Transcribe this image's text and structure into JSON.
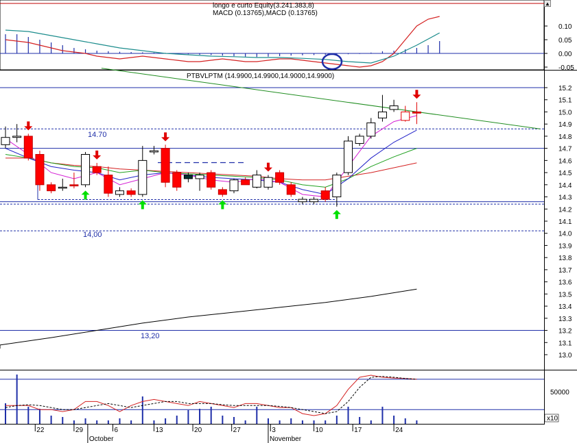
{
  "chart_data": [
    {
      "type": "line",
      "panel": "macd",
      "title_top": "longo e curto Equity(3.241.383,8)",
      "title": "MACD (0.13765),MACD (0.13765)",
      "ylim": [
        -0.06,
        0.15
      ],
      "y_ticks": [
        "0.10",
        "0.05",
        "0.00",
        "-0.05"
      ],
      "y_tick_values": [
        0.1,
        0.05,
        0.0,
        -0.05
      ],
      "series": [
        {
          "role": "macd",
          "color": "#d42020",
          "x": [
            0,
            5,
            10,
            15,
            20,
            25,
            30,
            35,
            40,
            45,
            50,
            55,
            60,
            65,
            70,
            75,
            80,
            85,
            90,
            95,
            100,
            105,
            110,
            115,
            120,
            125,
            130,
            135,
            140,
            145,
            150,
            155,
            160,
            165,
            170,
            175,
            180,
            185,
            190
          ],
          "values": [
            0.05,
            0.045,
            0.04,
            0.03,
            0.02,
            0.01,
            0.005,
            0.0,
            -0.01,
            -0.015,
            -0.02,
            -0.015,
            -0.01,
            -0.015,
            -0.02,
            -0.025,
            -0.03,
            -0.03,
            -0.025,
            -0.02,
            -0.025,
            -0.03,
            -0.03,
            -0.025,
            -0.02,
            -0.02,
            -0.025,
            -0.03,
            -0.035,
            -0.04,
            -0.045,
            -0.05,
            -0.045,
            -0.03,
            0.0,
            0.05,
            0.1,
            0.125,
            0.135
          ]
        },
        {
          "role": "signal",
          "color": "#1b8c8c",
          "x": [
            0,
            10,
            20,
            30,
            40,
            50,
            60,
            70,
            80,
            90,
            100,
            110,
            120,
            130,
            140,
            150,
            160,
            170,
            180,
            190
          ],
          "values": [
            0.085,
            0.08,
            0.065,
            0.05,
            0.035,
            0.02,
            0.01,
            0.0,
            -0.005,
            -0.01,
            -0.012,
            -0.015,
            -0.015,
            -0.018,
            -0.022,
            -0.03,
            -0.035,
            -0.01,
            0.03,
            0.075
          ]
        }
      ],
      "histogram": {
        "color": "#1e2ea8",
        "x": [
          0,
          5,
          10,
          15,
          20,
          25,
          30,
          35,
          40,
          45,
          50,
          55,
          60,
          65,
          70,
          75,
          80,
          85,
          90,
          95,
          100,
          105,
          110,
          115,
          120,
          125,
          130,
          135,
          140,
          145,
          150,
          155,
          160,
          165,
          170,
          175,
          180,
          185,
          190
        ],
        "values": [
          0.07,
          0.07,
          0.06,
          0.05,
          0.04,
          0.03,
          0.02,
          0.015,
          0.01,
          0.008,
          0.006,
          0.005,
          0.004,
          0.003,
          0.002,
          0.0,
          -0.003,
          -0.005,
          -0.006,
          -0.008,
          -0.01,
          -0.012,
          -0.013,
          -0.012,
          -0.01,
          -0.008,
          -0.007,
          -0.006,
          -0.005,
          -0.004,
          -0.003,
          -0.002,
          0.003,
          0.008,
          0.01,
          0.015,
          0.02,
          0.03,
          0.045
        ]
      },
      "hline": 0.0
    },
    {
      "type": "candlestick",
      "panel": "price",
      "title": "PTBVLPTM (14.9900,14.9900,14.9000,14.9900)",
      "ylim": [
        12.82,
        15.29
      ],
      "y_ticks": [
        "15.2",
        "15.1",
        "15.0",
        "14.9",
        "14.8",
        "14.7",
        "14.6",
        "14.5",
        "14.4",
        "14.3",
        "14.2",
        "14.1",
        "14.0",
        "13.9",
        "13.8",
        "13.7",
        "13.6",
        "13.5",
        "13.4",
        "13.3",
        "13.2",
        "13.1",
        "13.0"
      ],
      "y_tick_values": [
        15.2,
        15.1,
        15.0,
        14.9,
        14.8,
        14.7,
        14.6,
        14.5,
        14.4,
        14.3,
        14.2,
        14.1,
        14.0,
        13.9,
        13.8,
        13.7,
        13.6,
        13.5,
        13.4,
        13.3,
        13.2,
        13.1,
        13.0
      ],
      "annotations": [
        "14.70",
        "14,00",
        "13,20"
      ],
      "candles": [
        {
          "x": 0,
          "o": 14.73,
          "h": 14.88,
          "l": 14.7,
          "c": 14.79,
          "fill": "hollow"
        },
        {
          "x": 5,
          "o": 14.79,
          "h": 14.9,
          "l": 14.75,
          "c": 14.8,
          "fill": "hollow"
        },
        {
          "x": 10,
          "o": 14.8,
          "h": 14.82,
          "l": 14.6,
          "c": 14.62,
          "fill": "red"
        },
        {
          "x": 15,
          "o": 14.65,
          "h": 14.68,
          "l": 14.35,
          "c": 14.4,
          "fill": "red"
        },
        {
          "x": 20,
          "o": 14.4,
          "h": 14.42,
          "l": 14.33,
          "c": 14.35,
          "fill": "red"
        },
        {
          "x": 25,
          "o": 14.38,
          "h": 14.45,
          "l": 14.35,
          "c": 14.38,
          "fill": "hollow"
        },
        {
          "x": 30,
          "o": 14.4,
          "h": 14.5,
          "l": 14.37,
          "c": 14.39,
          "fill": "red"
        },
        {
          "x": 35,
          "o": 14.4,
          "h": 14.67,
          "l": 14.38,
          "c": 14.65,
          "fill": "hollow"
        },
        {
          "x": 40,
          "o": 14.55,
          "h": 14.58,
          "l": 14.48,
          "c": 14.5,
          "fill": "red"
        },
        {
          "x": 45,
          "o": 14.48,
          "h": 14.55,
          "l": 14.3,
          "c": 14.33,
          "fill": "red"
        },
        {
          "x": 50,
          "o": 14.32,
          "h": 14.38,
          "l": 14.3,
          "c": 14.35,
          "fill": "hollow"
        },
        {
          "x": 55,
          "o": 14.35,
          "h": 14.37,
          "l": 14.3,
          "c": 14.32,
          "fill": "red"
        },
        {
          "x": 60,
          "o": 14.32,
          "h": 14.72,
          "l": 14.3,
          "c": 14.6,
          "fill": "hollow"
        },
        {
          "x": 65,
          "o": 14.67,
          "h": 14.72,
          "l": 14.65,
          "c": 14.68,
          "fill": "hollow"
        },
        {
          "x": 70,
          "o": 14.7,
          "h": 14.73,
          "l": 14.38,
          "c": 14.42,
          "fill": "red"
        },
        {
          "x": 75,
          "o": 14.5,
          "h": 14.52,
          "l": 14.35,
          "c": 14.38,
          "fill": "red"
        },
        {
          "x": 80,
          "o": 14.45,
          "h": 14.5,
          "l": 14.42,
          "c": 14.48,
          "fill": "dark"
        },
        {
          "x": 85,
          "o": 14.48,
          "h": 14.5,
          "l": 14.35,
          "c": 14.45,
          "fill": "hollow"
        },
        {
          "x": 90,
          "o": 14.5,
          "h": 14.52,
          "l": 14.36,
          "c": 14.38,
          "fill": "red"
        },
        {
          "x": 95,
          "o": 14.36,
          "h": 14.38,
          "l": 14.3,
          "c": 14.32,
          "fill": "red"
        },
        {
          "x": 100,
          "o": 14.35,
          "h": 14.45,
          "l": 14.33,
          "c": 14.44,
          "fill": "hollow"
        },
        {
          "x": 105,
          "o": 14.44,
          "h": 14.46,
          "l": 14.4,
          "c": 14.4,
          "fill": "red"
        },
        {
          "x": 110,
          "o": 14.38,
          "h": 14.52,
          "l": 14.37,
          "c": 14.48,
          "fill": "hollow"
        },
        {
          "x": 115,
          "o": 14.38,
          "h": 14.48,
          "l": 14.36,
          "c": 14.46,
          "fill": "hollow"
        },
        {
          "x": 120,
          "o": 14.5,
          "h": 14.52,
          "l": 14.4,
          "c": 14.42,
          "fill": "red"
        },
        {
          "x": 125,
          "o": 14.4,
          "h": 14.42,
          "l": 14.3,
          "c": 14.32,
          "fill": "red"
        },
        {
          "x": 130,
          "o": 14.26,
          "h": 14.3,
          "l": 14.24,
          "c": 14.28,
          "fill": "hollow"
        },
        {
          "x": 135,
          "o": 14.26,
          "h": 14.3,
          "l": 14.24,
          "c": 14.28,
          "fill": "hollow"
        },
        {
          "x": 140,
          "o": 14.35,
          "h": 14.38,
          "l": 14.26,
          "c": 14.28,
          "fill": "red"
        },
        {
          "x": 145,
          "o": 14.3,
          "h": 14.5,
          "l": 14.22,
          "c": 14.48,
          "fill": "hollow"
        },
        {
          "x": 150,
          "o": 14.5,
          "h": 14.8,
          "l": 14.48,
          "c": 14.76,
          "fill": "hollow"
        },
        {
          "x": 155,
          "o": 14.74,
          "h": 14.82,
          "l": 14.72,
          "c": 14.8,
          "fill": "hollow"
        },
        {
          "x": 160,
          "o": 14.8,
          "h": 14.95,
          "l": 14.78,
          "c": 14.91,
          "fill": "hollow"
        },
        {
          "x": 165,
          "o": 14.95,
          "h": 15.14,
          "l": 14.92,
          "c": 15.0,
          "fill": "hollow"
        },
        {
          "x": 170,
          "o": 15.02,
          "h": 15.1,
          "l": 15.0,
          "c": 15.05,
          "fill": "hollow"
        },
        {
          "x": 175,
          "o": 14.93,
          "h": 15.05,
          "l": 14.92,
          "c": 15.0,
          "fill": "red-hollow"
        },
        {
          "x": 180,
          "o": 15.0,
          "h": 15.08,
          "l": 14.9,
          "c": 14.99,
          "fill": "red"
        }
      ],
      "moving_averages": [
        {
          "color": "#d42020",
          "x": [
            0,
            10,
            20,
            30,
            40,
            50,
            60,
            70,
            80,
            90,
            100,
            110,
            120,
            130,
            140,
            150,
            160,
            170,
            180
          ],
          "values": [
            14.62,
            14.62,
            14.58,
            14.56,
            14.55,
            14.53,
            14.52,
            14.51,
            14.5,
            14.49,
            14.48,
            14.47,
            14.45,
            14.44,
            14.44,
            14.47,
            14.5,
            14.54,
            14.58
          ]
        },
        {
          "color": "#1ea01e",
          "x": [
            0,
            10,
            20,
            30,
            40,
            50,
            60,
            70,
            80,
            90,
            100,
            110,
            120,
            130,
            140,
            150,
            160,
            170,
            180
          ],
          "values": [
            14.65,
            14.62,
            14.58,
            14.55,
            14.54,
            14.5,
            14.52,
            14.5,
            14.49,
            14.48,
            14.47,
            14.46,
            14.44,
            14.4,
            14.38,
            14.45,
            14.55,
            14.63,
            14.7
          ]
        },
        {
          "color": "#2020c8",
          "x": [
            0,
            10,
            20,
            30,
            40,
            50,
            60,
            70,
            80,
            90,
            100,
            110,
            120,
            130,
            140,
            150,
            160,
            170,
            180
          ],
          "values": [
            14.7,
            14.62,
            14.55,
            14.52,
            14.5,
            14.44,
            14.48,
            14.5,
            14.48,
            14.46,
            14.45,
            14.44,
            14.42,
            14.36,
            14.32,
            14.45,
            14.62,
            14.75,
            14.85
          ]
        },
        {
          "color": "#d41ed4",
          "x": [
            0,
            10,
            20,
            30,
            40,
            50,
            60,
            70,
            80,
            90,
            100,
            110,
            120,
            130,
            140,
            150,
            160,
            170,
            180
          ],
          "values": [
            14.78,
            14.65,
            14.5,
            14.45,
            14.5,
            14.4,
            14.45,
            14.5,
            14.48,
            14.44,
            14.42,
            14.45,
            14.42,
            14.32,
            14.3,
            14.55,
            14.8,
            14.92,
            14.97
          ]
        }
      ],
      "trendline": {
        "color": "#1e8c1e",
        "x": [
          42,
          234
        ],
        "values": [
          15.36,
          14.86
        ]
      },
      "long_ma": {
        "color": "#000000",
        "x": [
          0,
          20,
          40,
          60,
          80,
          100,
          120,
          140,
          160,
          180
        ],
        "values": [
          13.08,
          13.14,
          13.2,
          13.26,
          13.31,
          13.35,
          13.39,
          13.43,
          13.48,
          13.54
        ]
      },
      "hlines": [
        {
          "value": 15.2,
          "style": "solid"
        },
        {
          "value": 14.86,
          "style": "dashed"
        },
        {
          "value": 14.7,
          "style": "solid"
        },
        {
          "value": 14.26,
          "style": "solid"
        },
        {
          "value": 14.24,
          "style": "dashed"
        },
        {
          "value": 14.02,
          "style": "dashed"
        },
        {
          "value": 13.2,
          "style": "solid"
        }
      ],
      "sell_arrows_x": [
        10,
        40,
        70,
        115,
        180
      ],
      "buy_arrows_x": [
        35,
        60,
        95,
        145
      ]
    },
    {
      "type": "bar",
      "panel": "volume",
      "y_ticks": [
        "50000"
      ],
      "y_tick_values": [
        50000
      ],
      "scale_label": "x10",
      "volume_bars": {
        "color": "#1e2ea8",
        "x": [
          0,
          5,
          10,
          15,
          20,
          25,
          30,
          35,
          40,
          45,
          50,
          55,
          60,
          65,
          70,
          75,
          80,
          85,
          90,
          95,
          100,
          105,
          110,
          115,
          120,
          125,
          130,
          135,
          140,
          145,
          150,
          155,
          160,
          165,
          170,
          175,
          180
        ],
        "values": [
          0.3,
          0.72,
          0.25,
          0.22,
          0.12,
          0.1,
          0.05,
          0.08,
          0.05,
          0.05,
          0.08,
          0.05,
          0.4,
          0.05,
          0.08,
          0.12,
          0.2,
          0.22,
          0.25,
          0.12,
          0.1,
          0.05,
          0.25,
          0.08,
          0.05,
          0.08,
          0.05,
          0.05,
          0.05,
          0.12,
          0.25,
          0.1,
          0.05,
          0.25,
          0.12,
          0.08,
          0.05
        ]
      },
      "stoch_k": {
        "color": "#d42020",
        "x": [
          0,
          5,
          10,
          15,
          20,
          25,
          30,
          35,
          40,
          45,
          50,
          55,
          60,
          65,
          70,
          75,
          80,
          85,
          90,
          95,
          100,
          105,
          110,
          115,
          120,
          125,
          130,
          135,
          140,
          145,
          150,
          155,
          160,
          165,
          170,
          175,
          180
        ],
        "values": [
          0.3,
          0.3,
          0.3,
          0.2,
          0.2,
          0.15,
          0.2,
          0.4,
          0.4,
          0.3,
          0.15,
          0.3,
          0.4,
          0.45,
          0.4,
          0.35,
          0.3,
          0.4,
          0.35,
          0.3,
          0.25,
          0.35,
          0.35,
          0.3,
          0.25,
          0.25,
          0.1,
          0.05,
          0.1,
          0.3,
          0.7,
          1.0,
          1.05,
          1.0,
          0.98,
          0.97,
          0.95
        ]
      },
      "stoch_d": {
        "color": "#000000",
        "x": [
          0,
          5,
          10,
          15,
          20,
          25,
          30,
          35,
          40,
          45,
          50,
          55,
          60,
          65,
          70,
          75,
          80,
          85,
          90,
          95,
          100,
          105,
          110,
          115,
          120,
          125,
          130,
          135,
          140,
          145,
          150,
          155,
          160,
          165,
          170,
          175,
          180
        ],
        "values": [
          0.25,
          0.3,
          0.32,
          0.3,
          0.25,
          0.2,
          0.2,
          0.25,
          0.3,
          0.35,
          0.3,
          0.25,
          0.3,
          0.35,
          0.4,
          0.4,
          0.35,
          0.35,
          0.35,
          0.32,
          0.3,
          0.3,
          0.3,
          0.3,
          0.28,
          0.25,
          0.2,
          0.15,
          0.1,
          0.15,
          0.4,
          0.75,
          1.0,
          1.02,
          1.0,
          0.97,
          0.95
        ]
      },
      "hlines": [
        0.95,
        0.2
      ]
    }
  ],
  "x_axis": {
    "day_labels": [
      "22",
      "29",
      "6",
      "13",
      "20",
      "27",
      "3",
      "10",
      "17",
      "24"
    ],
    "day_x": [
      13,
      30,
      47,
      65,
      82,
      99,
      116,
      135,
      152,
      170
    ],
    "month_labels": [
      "October",
      "November"
    ],
    "month_x": [
      36,
      115
    ]
  },
  "scroll_button": "▲"
}
